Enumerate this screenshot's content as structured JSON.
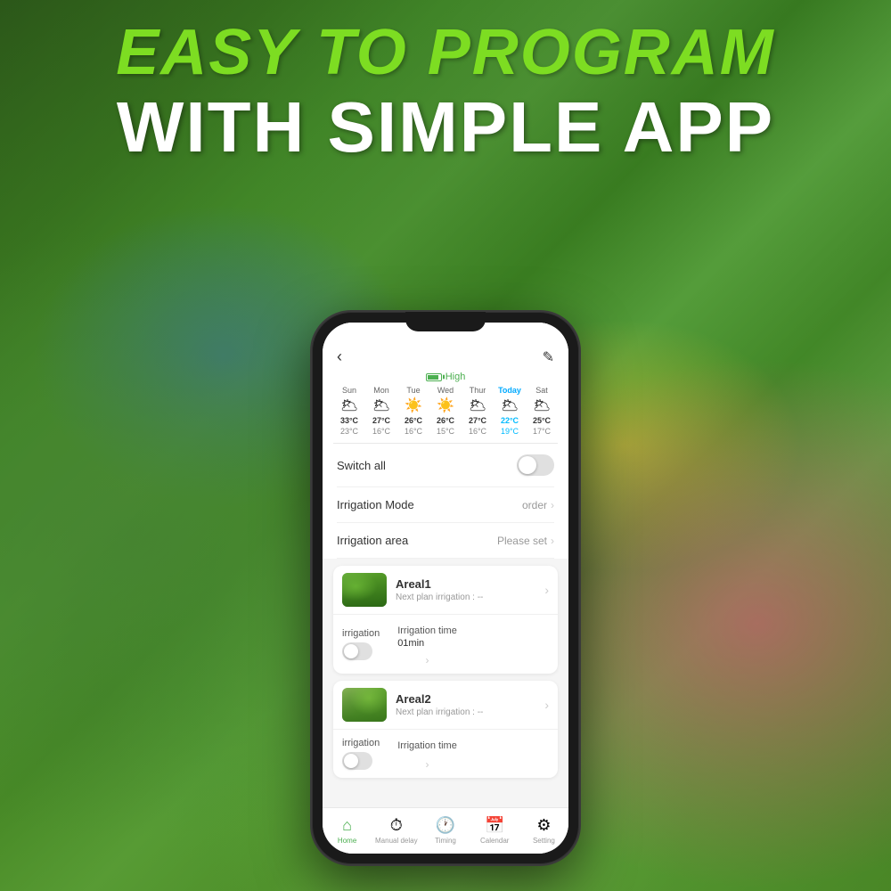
{
  "headline": {
    "line1": "EASY TO PROGRAM",
    "line2": "WITH SIMPLE APP"
  },
  "phone": {
    "battery_label": "High",
    "weather": {
      "days": [
        {
          "label": "Sun",
          "icon": "🌥",
          "high": "33°C",
          "low": "23°C",
          "today": false
        },
        {
          "label": "Mon",
          "icon": "🌥",
          "high": "27°C",
          "low": "16°C",
          "today": false
        },
        {
          "label": "Tue",
          "icon": "☀️",
          "high": "26°C",
          "low": "16°C",
          "today": false
        },
        {
          "label": "Wed",
          "icon": "☀️",
          "high": "26°C",
          "low": "15°C",
          "today": false
        },
        {
          "label": "Thur",
          "icon": "🌥",
          "high": "27°C",
          "low": "16°C",
          "today": false
        },
        {
          "label": "Today",
          "icon": "🌥",
          "high": "22°C",
          "low": "19°C",
          "today": true
        },
        {
          "label": "Sat",
          "icon": "🌥",
          "high": "25°C",
          "low": "17°C",
          "today": false
        }
      ]
    },
    "controls": {
      "switch_all_label": "Switch all",
      "irrigation_mode_label": "Irrigation Mode",
      "irrigation_mode_value": "order",
      "irrigation_area_label": "Irrigation area",
      "irrigation_area_value": "Please set"
    },
    "areas": [
      {
        "name": "Areal1",
        "next_label": "Next plan irrigation :",
        "next_value": "--",
        "irrigation_label": "irrigation",
        "irrigation_time_label": "Irrigation time",
        "irrigation_time_value": "01min"
      },
      {
        "name": "Areal2",
        "next_label": "Next plan irrigation :",
        "next_value": "--",
        "irrigation_label": "irrigation",
        "irrigation_time_label": "Irrigation time",
        "irrigation_time_value": ""
      }
    ],
    "nav": {
      "items": [
        {
          "icon": "🏠",
          "label": "Home",
          "active": true
        },
        {
          "icon": "⏱",
          "label": "Manual delay",
          "active": false
        },
        {
          "icon": "🕐",
          "label": "Timing",
          "active": false
        },
        {
          "icon": "📅",
          "label": "Calendar",
          "active": false
        },
        {
          "icon": "⚙️",
          "label": "Setting",
          "active": false
        }
      ]
    }
  }
}
